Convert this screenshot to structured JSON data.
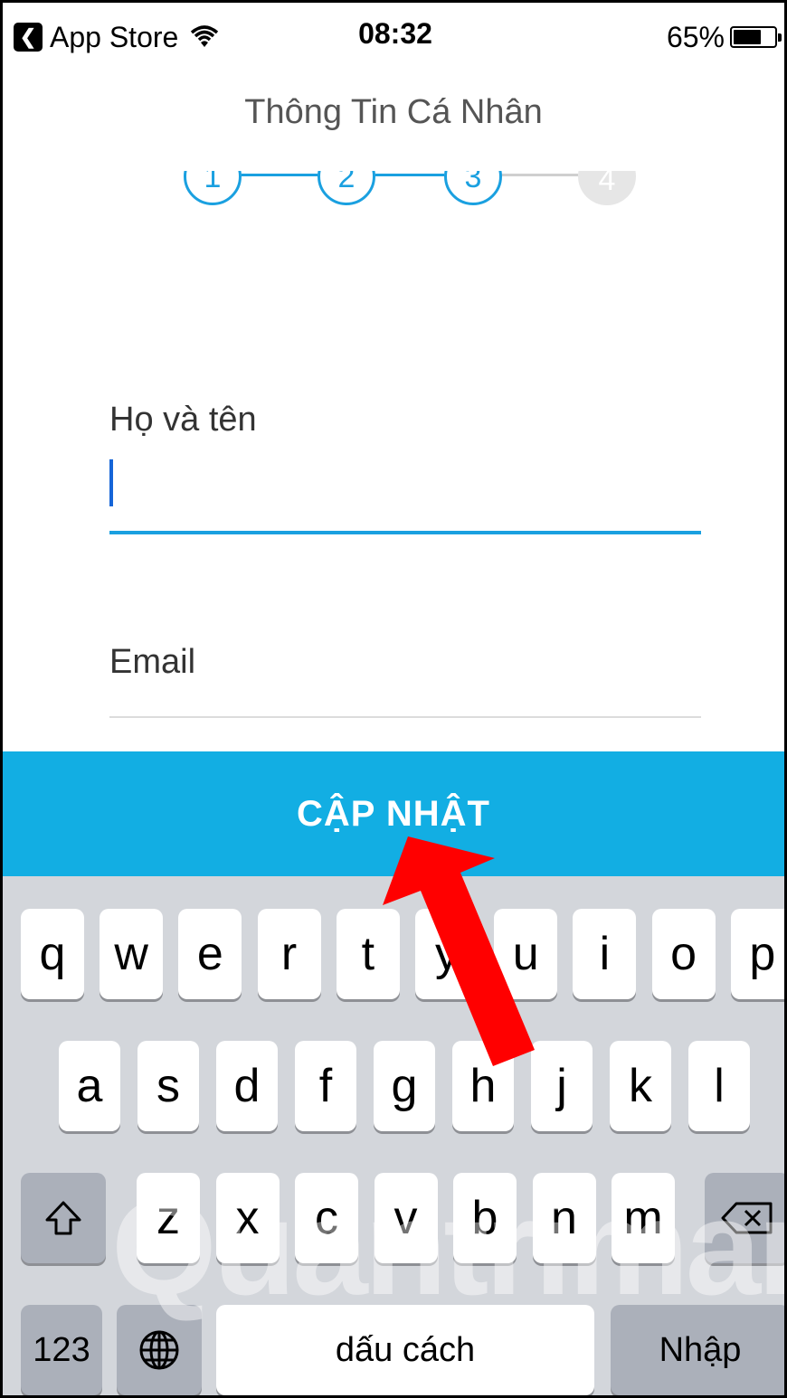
{
  "status_bar": {
    "carrier": "App Store",
    "time": "08:32",
    "battery": "65%",
    "battery_level": 0.65
  },
  "screen": {
    "title": "Thông Tin Cá Nhân",
    "steps": [
      "1",
      "2",
      "3",
      "4"
    ],
    "current_step": 3
  },
  "form": {
    "name_label": "Họ và tên",
    "name_value": "",
    "email_label": "Email",
    "email_value": ""
  },
  "update_button": "CẬP NHẬT",
  "keyboard": {
    "row1": [
      "q",
      "w",
      "e",
      "r",
      "t",
      "y",
      "u",
      "i",
      "o",
      "p"
    ],
    "row2": [
      "a",
      "s",
      "d",
      "f",
      "g",
      "h",
      "j",
      "k",
      "l"
    ],
    "row3": [
      "z",
      "x",
      "c",
      "v",
      "b",
      "n",
      "m"
    ],
    "numbers_key": "123",
    "space_key": "dấu cách",
    "return_key": "Nhập"
  },
  "watermark": "Quantrimang",
  "colors": {
    "accent": "#12aee3",
    "annotation_arrow": "#ff0000"
  }
}
